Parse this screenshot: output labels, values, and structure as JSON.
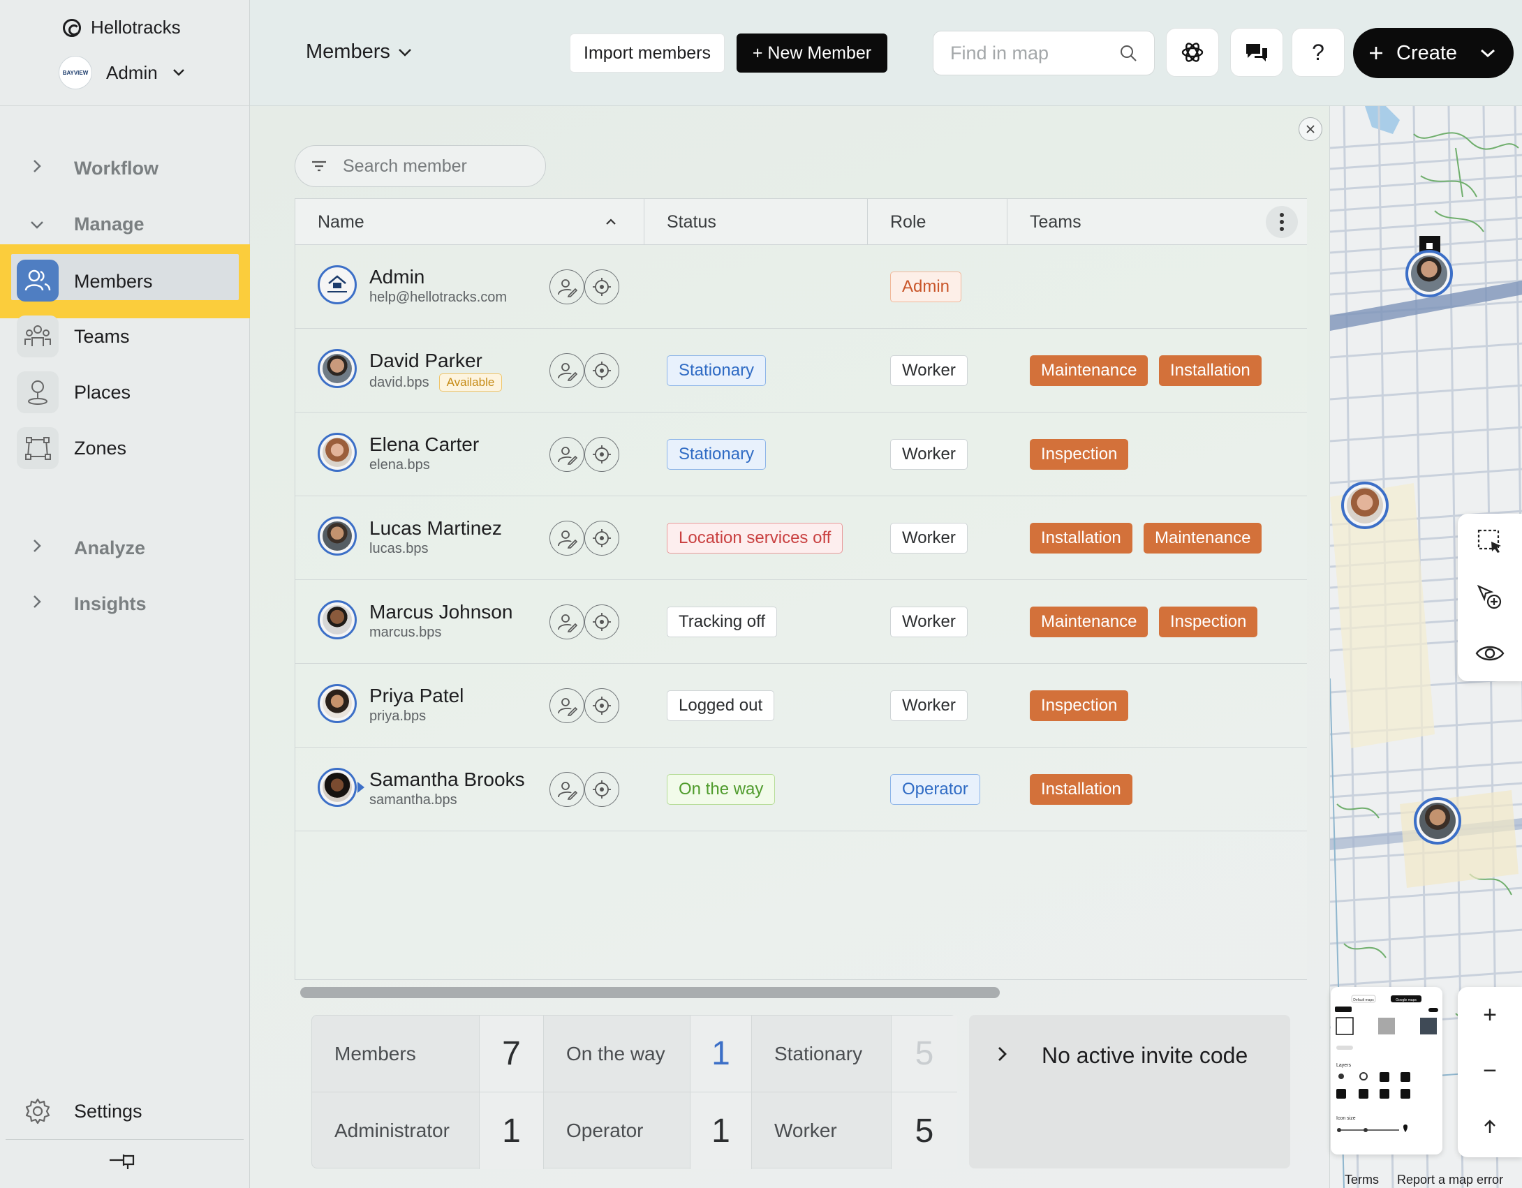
{
  "app": {
    "name": "Hellotracks",
    "account_label": "Admin",
    "account_logo_text": "BAYVIEW"
  },
  "sidebar": {
    "sections": {
      "workflow": "Workflow",
      "manage": "Manage",
      "analyze": "Analyze",
      "insights": "Insights"
    },
    "items": [
      {
        "label": "Members",
        "icon": "members-icon",
        "active": true
      },
      {
        "label": "Teams",
        "icon": "teams-icon",
        "active": false
      },
      {
        "label": "Places",
        "icon": "places-icon",
        "active": false
      },
      {
        "label": "Zones",
        "icon": "zones-icon",
        "active": false
      }
    ],
    "settings_label": "Settings",
    "accent_color": "#fbcd3c",
    "active_icon_color": "#4f7ec2"
  },
  "header": {
    "title": "Members",
    "import_label": "Import members",
    "new_member_label": "+ New Member",
    "find_placeholder": "Find in map",
    "help_label": "?",
    "create_label": "Create"
  },
  "members_panel": {
    "search_placeholder": "Search member",
    "columns": [
      "Name",
      "Status",
      "Role",
      "Teams"
    ],
    "rows": [
      {
        "name": "Admin",
        "sub": "help@hellotracks.com",
        "badge": "",
        "status": "",
        "status_style": "",
        "role": "Admin",
        "role_style": "admin",
        "teams": []
      },
      {
        "name": "David Parker",
        "sub": "david.bps",
        "badge": "Available",
        "status": "Stationary",
        "status_style": "stationary",
        "role": "Worker",
        "role_style": "plain",
        "teams": [
          "Maintenance",
          "Installation"
        ]
      },
      {
        "name": "Elena Carter",
        "sub": "elena.bps",
        "badge": "",
        "status": "Stationary",
        "status_style": "stationary",
        "role": "Worker",
        "role_style": "plain",
        "teams": [
          "Inspection"
        ]
      },
      {
        "name": "Lucas Martinez",
        "sub": "lucas.bps",
        "badge": "",
        "status": "Location services off",
        "status_style": "locoff",
        "role": "Worker",
        "role_style": "plain",
        "teams": [
          "Installation",
          "Maintenance"
        ]
      },
      {
        "name": "Marcus Johnson",
        "sub": "marcus.bps",
        "badge": "",
        "status": "Tracking off",
        "status_style": "plain",
        "role": "Worker",
        "role_style": "plain",
        "teams": [
          "Maintenance",
          "Inspection"
        ]
      },
      {
        "name": "Priya Patel",
        "sub": "priya.bps",
        "badge": "",
        "status": "Logged out",
        "status_style": "plain",
        "role": "Worker",
        "role_style": "plain",
        "teams": [
          "Inspection"
        ]
      },
      {
        "name": "Samantha Brooks",
        "sub": "samantha.bps",
        "badge": "",
        "status": "On the way",
        "status_style": "ontheway",
        "role": "Operator",
        "role_style": "operator",
        "teams": [
          "Installation"
        ]
      }
    ],
    "team_color": "#d3713a"
  },
  "stats": {
    "members_label": "Members",
    "members_value": "7",
    "ontheway_label": "On the way",
    "ontheway_value": "1",
    "stationary_label": "Stationary",
    "stationary_value": "5",
    "administrator_label": "Administrator",
    "administrator_value": "1",
    "operator_label": "Operator",
    "operator_value": "1",
    "worker_label": "Worker",
    "worker_value": "5"
  },
  "invite": {
    "label": "No active invite code"
  },
  "map": {
    "zoom_in": "+",
    "zoom_out": "−",
    "footer_terms": "Terms",
    "footer_report": "Report a map error",
    "layers_panel": {
      "tab_default": "Default maps",
      "tab_google": "Google maps",
      "layers_label": "Layers",
      "icon_size_label": "Icon size"
    }
  }
}
